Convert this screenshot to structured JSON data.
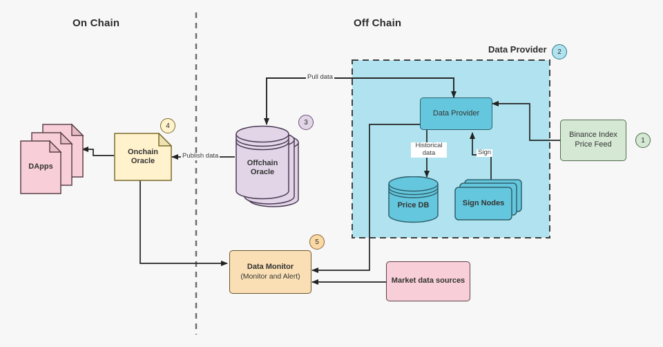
{
  "sections": [
    {
      "id": "on-chain",
      "title": "On Chain"
    },
    {
      "id": "off-chain",
      "title": "Off Chain"
    }
  ],
  "group": {
    "title": "Data Provider",
    "badge": "2"
  },
  "nodes": {
    "dapps": {
      "label": "DApps",
      "shape": "note-stack",
      "color": "#f8cfd8"
    },
    "onchain_oracle": {
      "label_line1": "Onchain",
      "label_line2": "Oracle",
      "shape": "note",
      "color": "#fff2cc",
      "badge": "4"
    },
    "offchain_oracle": {
      "label": "Offchain Oracle",
      "shape": "cylinder-stack",
      "color": "#e1d5e7",
      "badge": "3"
    },
    "data_provider": {
      "label": "Data Provider",
      "shape": "rect",
      "color": "#64c7dd"
    },
    "price_db": {
      "label": "Price DB",
      "shape": "cylinder",
      "color": "#64c7dd"
    },
    "sign_nodes": {
      "label": "Sign Nodes",
      "shape": "rect-stack",
      "color": "#64c7dd"
    },
    "binance_feed": {
      "label_line1": "Binance Index",
      "label_line2": "Price Feed",
      "shape": "rect",
      "color": "#d5e8d4",
      "badge": "1"
    },
    "data_monitor": {
      "label_line1": "Data Monitor",
      "label_line2": "(Monitor and Alert)",
      "shape": "rect",
      "color": "#fadfb4",
      "badge": "5"
    },
    "market_sources": {
      "label": "Market data sources",
      "shape": "rect",
      "color": "#f8cfd8"
    }
  },
  "edges": [
    {
      "id": "pull-data",
      "label": "Pull data",
      "from": "data_provider",
      "to": "offchain_oracle"
    },
    {
      "id": "publish-data",
      "label": "Publish data",
      "from": "offchain_oracle",
      "to": "onchain_oracle"
    },
    {
      "id": "historical",
      "label": "Historical\ndata",
      "label_line1": "Historical",
      "label_line2": "data",
      "from": "data_provider",
      "to": "price_db"
    },
    {
      "id": "sign",
      "label": "Sign",
      "from": "sign_nodes",
      "to": "data_provider"
    },
    {
      "id": "feed-to-dp",
      "label": "",
      "from": "binance_feed",
      "to": "data_provider"
    },
    {
      "id": "oracle-to-dapps",
      "label": "",
      "from": "onchain_oracle",
      "to": "dapps"
    },
    {
      "id": "oracle-to-monitor",
      "label": "",
      "from": "onchain_oracle",
      "to": "data_monitor"
    },
    {
      "id": "dp-to-monitor",
      "label": "",
      "from": "data_provider",
      "to": "data_monitor"
    },
    {
      "id": "market-to-monitor",
      "label": "",
      "from": "market_sources",
      "to": "data_monitor"
    }
  ],
  "colors": {
    "background": "#f7f7f7",
    "stroke": "#3f3f3f",
    "group_fill": "#b0e3ef",
    "green": "#d5e8d4",
    "pink": "#f8cfd8",
    "yellow": "#fff2cc",
    "purple": "#e1d5e7",
    "cyan": "#64c7dd",
    "orange": "#fadfb4"
  }
}
